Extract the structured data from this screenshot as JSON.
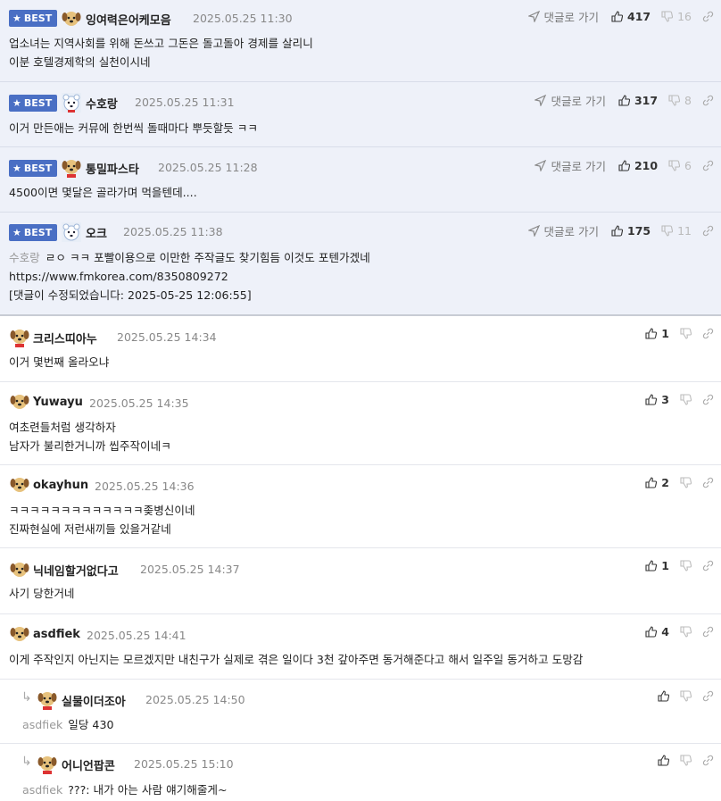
{
  "labels": {
    "best": "BEST",
    "reply_to": "댓글로 가기"
  },
  "best_comments": [
    {
      "nick": "잉여력은어케모음",
      "date": "2025.05.25 11:30",
      "up": "417",
      "down": "16",
      "lines": [
        "업소녀는 지역사회를 위해 돈쓰고 그돈은 돌고돌아 경제를 살리니",
        "이분 호텔경제학의 실천이시네"
      ]
    },
    {
      "nick": "수호랑",
      "date": "2025.05.25 11:31",
      "up": "317",
      "down": "8",
      "lines": [
        "이거 만든애는 커뮤에 한번씩 돌때마다 뿌듯할듯 ㅋㅋ"
      ]
    },
    {
      "nick": "통밀파스타",
      "date": "2025.05.25 11:28",
      "up": "210",
      "down": "6",
      "lines": [
        "4500이면 몇달은 골라가며 먹을텐데...."
      ]
    },
    {
      "nick": "오크",
      "date": "2025.05.25 11:38",
      "up": "175",
      "down": "11",
      "target": "수호랑",
      "lines": [
        "ㄹㅇ ㅋㅋ 포빨이용으로 이만한 주작글도 찾기힘듬 이것도 포텐가겠네",
        "https://www.fmkorea.com/8350809272",
        "[댓글이 수정되었습니다: 2025-05-25 12:06:55]"
      ]
    }
  ],
  "comments": [
    {
      "nick": "크리스띠아누",
      "date": "2025.05.25 14:34",
      "up": "1",
      "lines": [
        "이거 몇번째 올라오냐"
      ]
    },
    {
      "nick": "Yuwayu",
      "date": "2025.05.25 14:35",
      "up": "3",
      "lines": [
        "여초련들처럼 생각하자",
        "남자가 불리한거니까 씹주작이네ㅋ"
      ]
    },
    {
      "nick": "okayhun",
      "date": "2025.05.25 14:36",
      "up": "2",
      "lines": [
        "ㅋㅋㅋㅋㅋㅋㅋㅋㅋㅋㅋㅋㅋ좆병신이네",
        "진짜현실에 저런새끼들 있을거같네"
      ]
    },
    {
      "nick": "닉네임할거없다고",
      "date": "2025.05.25 14:37",
      "up": "1",
      "lines": [
        "사기 당한거네"
      ]
    },
    {
      "nick": "asdfiek",
      "date": "2025.05.25 14:41",
      "up": "4",
      "lines": [
        "이게 주작인지 아닌지는 모르겠지만 내친구가 실제로 겪은 일이다 3천 갚아주면 동거해준다고 해서 일주일 동거하고 도망감"
      ]
    },
    {
      "nick": "실물이더조아",
      "date": "2025.05.25 14:50",
      "up": "",
      "target": "asdfiek",
      "lines": [
        "일당 430"
      ]
    },
    {
      "nick": "어니언팝콘",
      "date": "2025.05.25 15:10",
      "up": "",
      "target": "asdfiek",
      "lines": [
        "???: 내가 아는 사람 얘기해줄게~"
      ]
    }
  ],
  "colors": {
    "best_bg": "#eef1f9",
    "badge": "#4a6fc4"
  }
}
